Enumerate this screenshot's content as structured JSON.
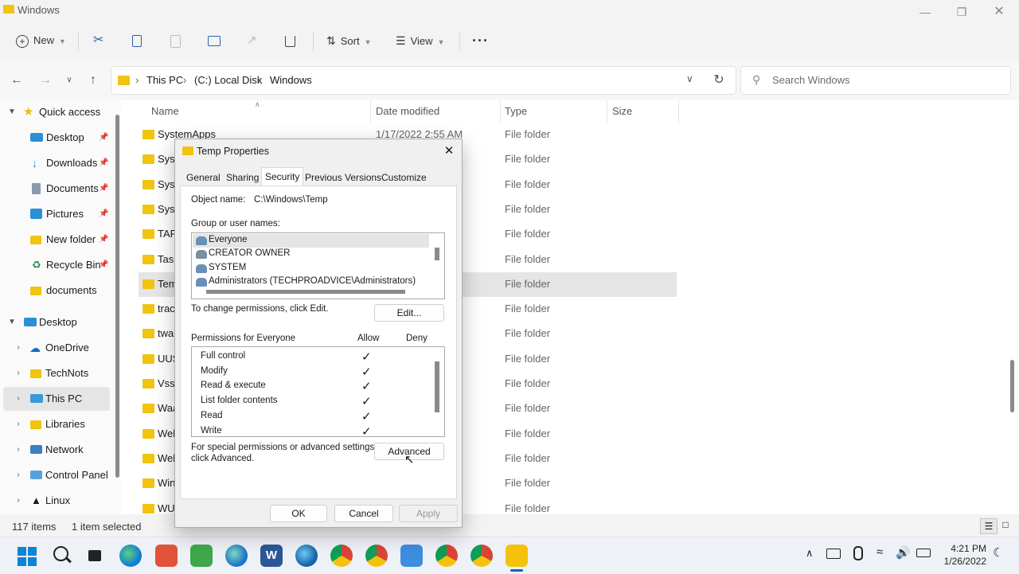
{
  "window": {
    "title": "Windows"
  },
  "toolbar": {
    "new_label": "New",
    "sort_label": "Sort",
    "view_label": "View"
  },
  "address": {
    "parts": [
      "This PC",
      "(C:) Local Disk",
      "Windows"
    ],
    "search_placeholder": "Search Windows"
  },
  "nav": {
    "quick_access": "Quick access",
    "items": [
      "Desktop",
      "Downloads",
      "Documents",
      "Pictures",
      "New folder",
      "Recycle Bin",
      "documents"
    ],
    "desktop": "Desktop",
    "tree": [
      "OneDrive",
      "TechNots",
      "This PC",
      "Libraries",
      "Network",
      "Control Panel",
      "Linux"
    ]
  },
  "columns": {
    "name": "Name",
    "date": "Date modified",
    "type": "Type",
    "size": "Size"
  },
  "files": [
    {
      "name": "SystemApps",
      "date": "1/17/2022 2:55 AM",
      "type": "File folder"
    },
    {
      "name": "Syst",
      "type": "File folder"
    },
    {
      "name": "Syst",
      "type": "File folder"
    },
    {
      "name": "Sys\\",
      "type": "File folder"
    },
    {
      "name": "TAP",
      "type": "File folder"
    },
    {
      "name": "Task",
      "type": "File folder"
    },
    {
      "name": "Tem",
      "type": "File folder"
    },
    {
      "name": "traci",
      "type": "File folder"
    },
    {
      "name": "twai",
      "type": "File folder"
    },
    {
      "name": "UUS",
      "type": "File folder"
    },
    {
      "name": "Vss",
      "type": "File folder"
    },
    {
      "name": "Waa",
      "type": "File folder"
    },
    {
      "name": "Web",
      "type": "File folder"
    },
    {
      "name": "Web",
      "type": "File folder"
    },
    {
      "name": "Win",
      "type": "File folder"
    },
    {
      "name": "WUI",
      "type": "File folder"
    }
  ],
  "status": {
    "count": "117 items",
    "selected": "1 item selected"
  },
  "dialog": {
    "title": "Temp Properties",
    "tabs": [
      "General",
      "Sharing",
      "Security",
      "Previous Versions",
      "Customize"
    ],
    "object_label": "Object name:",
    "object_value": "C:\\Windows\\Temp",
    "group_label": "Group or user names:",
    "users": [
      "Everyone",
      "CREATOR OWNER",
      "SYSTEM",
      "Administrators (TECHPROADVICE\\Administrators)"
    ],
    "change_text": "To change permissions, click Edit.",
    "edit_label": "Edit...",
    "perm_label": "Permissions for Everyone",
    "allow_label": "Allow",
    "deny_label": "Deny",
    "perms": [
      "Full control",
      "Modify",
      "Read & execute",
      "List folder contents",
      "Read",
      "Write"
    ],
    "special_text_1": "For special permissions or advanced settings,",
    "special_text_2": "click Advanced.",
    "advanced_label": "Advanced",
    "ok_label": "OK",
    "cancel_label": "Cancel",
    "apply_label": "Apply"
  },
  "clock": {
    "time": "4:21 PM",
    "date": "1/26/2022"
  },
  "colors": {
    "accent": "#0067c0",
    "folder": "#f1c40f",
    "selection": "#e5e5e5"
  }
}
